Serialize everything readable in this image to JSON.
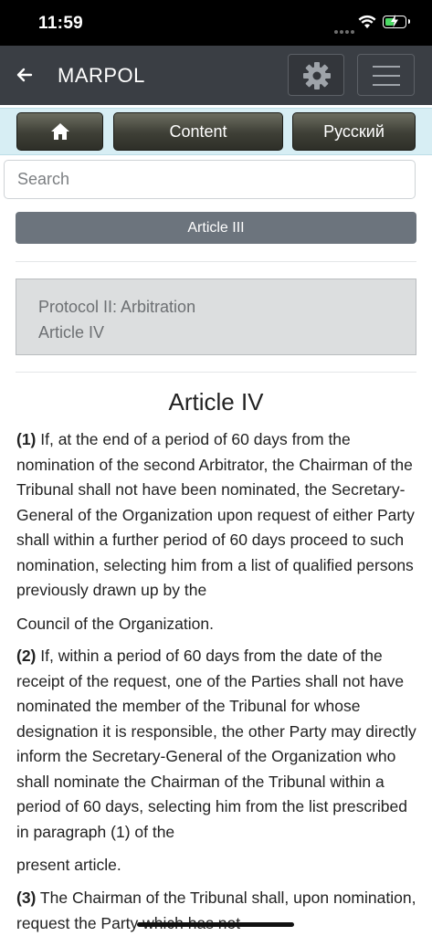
{
  "status_bar": {
    "time": "11:59"
  },
  "header": {
    "title": "MARPOL"
  },
  "nav": {
    "content_label": "Content",
    "language_label": "Русский"
  },
  "search": {
    "placeholder": "Search"
  },
  "prev_article_label": "Article III",
  "breadcrumb": {
    "line1": "Protocol II: Arbitration",
    "line2": "Article IV"
  },
  "article": {
    "title": "Article IV",
    "paragraphs": [
      {
        "num": "(1)",
        "text": " If, at the end of a period of 60 days from the nomination of the second Arbitrator, the Chairman of the Tribunal shall not have been nominated, the Secretary-General of the Organization upon request of either Party shall within a further period of 60 days proceed to such nomination, selecting him from a list of qualified persons previously drawn up by the",
        "tail": "Council of the Organization."
      },
      {
        "num": "(2)",
        "text": " If, within a period of 60 days from the date of the receipt of the request, one of the Parties shall not have nominated the member of the Tribunal for whose designation it is responsible, the other Party may directly inform the Secretary-General of the Organization who shall nominate the Chairman of the Tribunal within a period of 60 days, selecting him from the list prescribed in paragraph (1) of the",
        "tail": "present article."
      },
      {
        "num": "(3)",
        "text": " The Chairman of the Tribunal shall, upon nomination, request the Party which has not"
      }
    ]
  }
}
